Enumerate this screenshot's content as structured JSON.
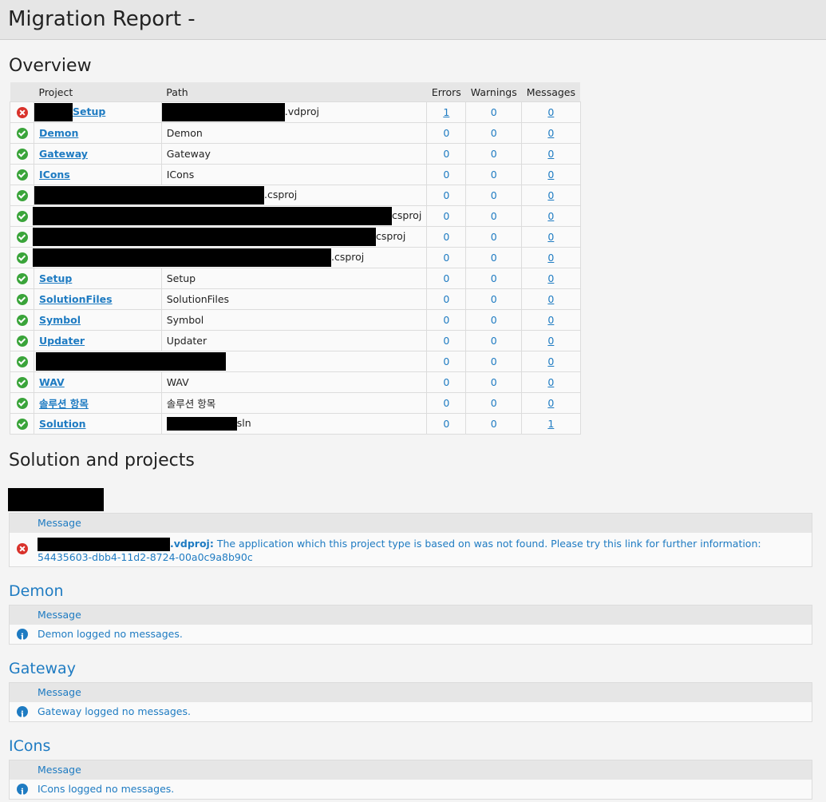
{
  "title": "Migration Report -",
  "overview": {
    "heading": "Overview",
    "columns": [
      "Project",
      "Path",
      "Errors",
      "Warnings",
      "Messages"
    ],
    "rows": [
      {
        "status": "error",
        "project": "Setup",
        "path": ".vdproj",
        "errors": "1",
        "warnings": "0",
        "messages": "0"
      },
      {
        "status": "ok",
        "project": "Demon",
        "path": "Demon",
        "errors": "0",
        "warnings": "0",
        "messages": "0"
      },
      {
        "status": "ok",
        "project": "Gateway",
        "path": "Gateway",
        "errors": "0",
        "warnings": "0",
        "messages": "0"
      },
      {
        "status": "ok",
        "project": "ICons",
        "path": "ICons",
        "errors": "0",
        "warnings": "0",
        "messages": "0"
      },
      {
        "status": "ok",
        "project": "",
        "path": ".csproj",
        "errors": "0",
        "warnings": "0",
        "messages": "0"
      },
      {
        "status": "ok",
        "project": "",
        "path": "csproj",
        "errors": "0",
        "warnings": "0",
        "messages": "0"
      },
      {
        "status": "ok",
        "project": "",
        "path": "csproj",
        "errors": "0",
        "warnings": "0",
        "messages": "0"
      },
      {
        "status": "ok",
        "project": "",
        "path": ".csproj",
        "errors": "0",
        "warnings": "0",
        "messages": "0"
      },
      {
        "status": "ok",
        "project": "Setup",
        "path": "Setup",
        "errors": "0",
        "warnings": "0",
        "messages": "0"
      },
      {
        "status": "ok",
        "project": "SolutionFiles",
        "path": "SolutionFiles",
        "errors": "0",
        "warnings": "0",
        "messages": "0"
      },
      {
        "status": "ok",
        "project": "Symbol",
        "path": "Symbol",
        "errors": "0",
        "warnings": "0",
        "messages": "0"
      },
      {
        "status": "ok",
        "project": "Updater",
        "path": "Updater",
        "errors": "0",
        "warnings": "0",
        "messages": "0"
      },
      {
        "status": "ok",
        "project": "",
        "path": "",
        "errors": "0",
        "warnings": "0",
        "messages": "0"
      },
      {
        "status": "ok",
        "project": "WAV",
        "path": "WAV",
        "errors": "0",
        "warnings": "0",
        "messages": "0"
      },
      {
        "status": "ok",
        "project": "솔루션 항목",
        "path": "솔루션 항목",
        "errors": "0",
        "warnings": "0",
        "messages": "0"
      },
      {
        "status": "ok",
        "project": "Solution",
        "path": "sln",
        "errors": "0",
        "warnings": "0",
        "messages": "1"
      }
    ]
  },
  "solution_section": {
    "heading": "Solution and projects",
    "message_header": "Message",
    "first_block": {
      "file_suffix": ".vdproj:",
      "text": "The application which this project type is based on was not found. Please try this link for further information: 54435603-dbb4-11d2-8724-00a0c9a8b90c"
    },
    "blocks": [
      {
        "title": "Demon",
        "message": "Demon logged no messages."
      },
      {
        "title": "Gateway",
        "message": "Gateway logged no messages."
      },
      {
        "title": "ICons",
        "message": "ICons logged no messages."
      }
    ]
  },
  "colors": {
    "link": "#1e7bc2",
    "ok": "#3aa43a",
    "error": "#d9322b",
    "header_bg": "#e6e6e6"
  },
  "icons": {
    "ok": "check-circle-icon",
    "error": "error-x-icon",
    "info": "info-icon"
  }
}
